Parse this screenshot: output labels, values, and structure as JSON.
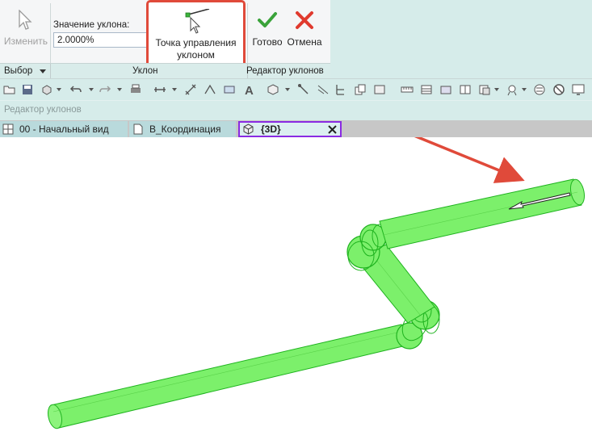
{
  "ribbon": {
    "modify_label": "Изменить",
    "slope_label": "Значение уклона:",
    "slope_value": "2.0000%",
    "control_point_label_line1": "Точка управления",
    "control_point_label_line2": "уклоном",
    "done_label": "Готово",
    "cancel_label": "Отмена",
    "panels": [
      "Выбор",
      "Уклон",
      "Редактор уклонов"
    ]
  },
  "options_bar": {
    "label": "Редактор уклонов"
  },
  "view_tabs": [
    {
      "label": "00 - Начальный вид"
    },
    {
      "label": "В_Координация"
    },
    {
      "label": "{3D}"
    }
  ],
  "colors": {
    "highlight_border": "#e04a3a",
    "arrow": "#e04a3a",
    "pipe_fill": "#7cf06b",
    "pipe_edge": "#1fb31f",
    "active_tab_border": "#8a2be2",
    "ribbon_teal": "#d6ecea"
  },
  "icons": [
    "cursor-icon",
    "slope-control-point-icon",
    "checkmark-icon",
    "cross-icon",
    "view-3d-icon",
    "close-icon"
  ]
}
